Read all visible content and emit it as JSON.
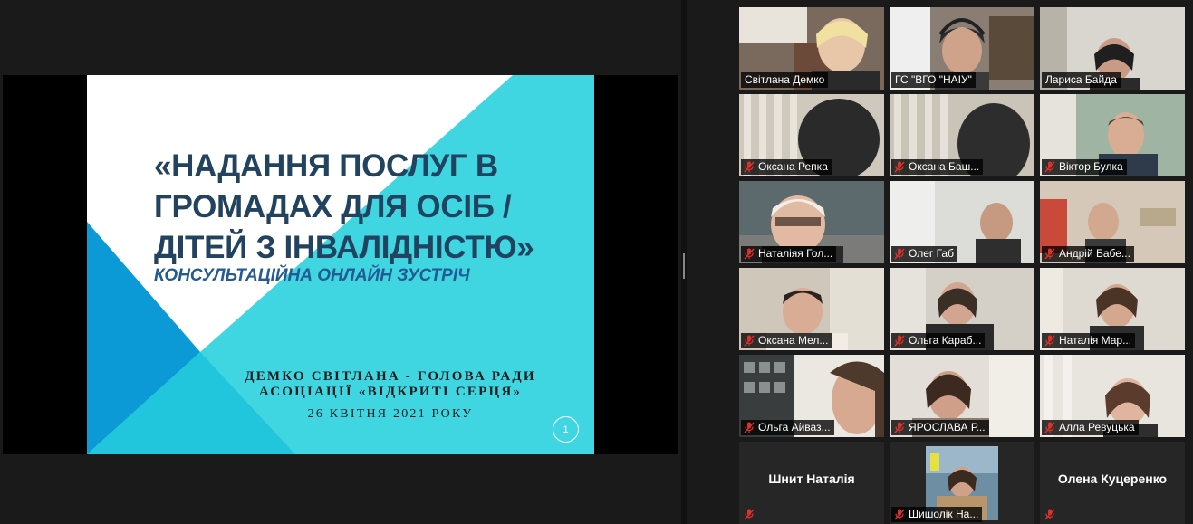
{
  "slide": {
    "title_lines": [
      "«НАДАННЯ ПОСЛУГ В",
      "ГРОМАДАХ  ДЛЯ ОСІБ /",
      "ДІТЕЙ З ІНВАЛІДНІСТЮ»"
    ],
    "subtitle": "КОНСУЛЬТАЦІЙНА ОНЛАЙН ЗУСТРІЧ",
    "author_lines": [
      "ДЕМКО СВІТЛАНА - ГОЛОВА РАДИ",
      "АСОЦІАЦІЇ «ВІДКРИТІ СЕРЦЯ»"
    ],
    "date": "26 КВІТНЯ 2021 РОКУ",
    "page_number": "1",
    "colors": {
      "cyan": "#3fd6e2",
      "blue": "#0b9ad6",
      "white": "#ffffff",
      "title": "#22435f",
      "subtitle": "#245a92"
    }
  },
  "participants": [
    {
      "name": "Світлана Демко",
      "muted": false
    },
    {
      "name": "ГС \"ВГО \"НАІУ\"",
      "muted": false
    },
    {
      "name": "Лариса Байда",
      "muted": false,
      "active_speaker": true
    },
    {
      "name": "Оксана Репка",
      "muted": true
    },
    {
      "name": "Оксана Баш...",
      "muted": true
    },
    {
      "name": "Віктор Булка",
      "muted": true
    },
    {
      "name": "Наталіяя Гол...",
      "muted": true
    },
    {
      "name": "Олег Габ",
      "muted": true
    },
    {
      "name": "Андрій Бабе...",
      "muted": true
    },
    {
      "name": "Оксана Мел...",
      "muted": true
    },
    {
      "name": "Ольга Караб...",
      "muted": true
    },
    {
      "name": "Наталія Мар...",
      "muted": true
    },
    {
      "name": "Ольга Айваз...",
      "muted": true
    },
    {
      "name": "ЯРОСЛАВА Р...",
      "muted": true
    },
    {
      "name": "Алла Ревуцька",
      "muted": true
    },
    {
      "name": "Шнит Наталія",
      "muted": true,
      "video": false
    },
    {
      "name": "Шишолік На...",
      "muted": true
    },
    {
      "name": "Олена Куцеренко",
      "muted": true,
      "video": false
    }
  ],
  "ui_colors": {
    "mute_red": "#e0302a",
    "active_outline": "#c8e06a"
  }
}
